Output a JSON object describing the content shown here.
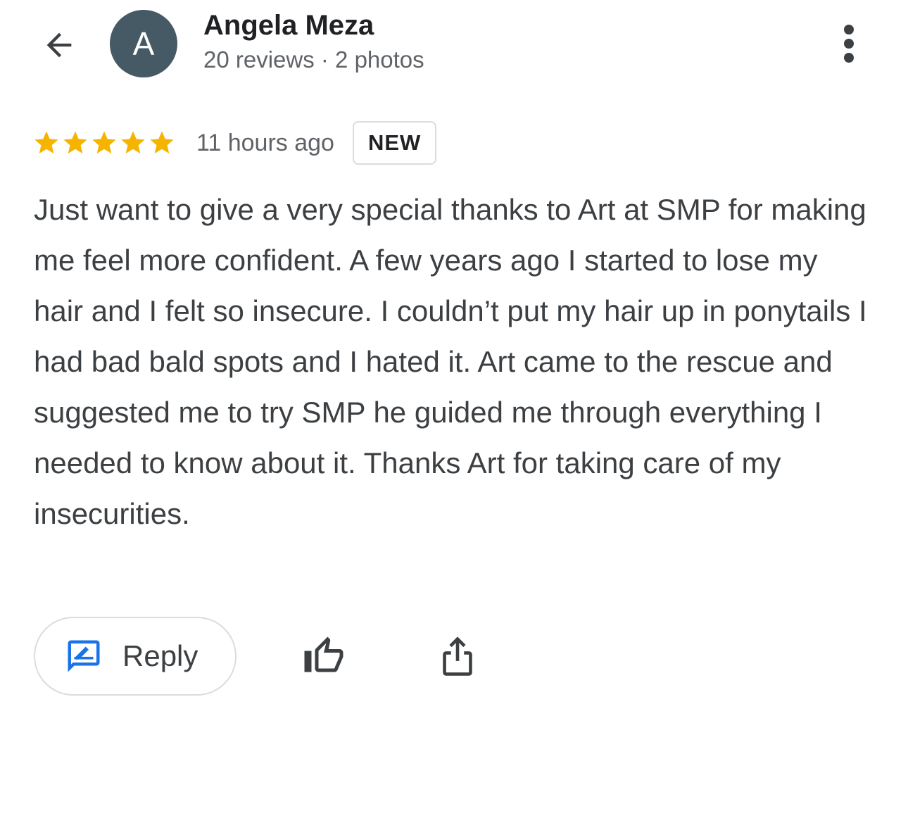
{
  "header": {
    "avatar_letter": "A",
    "reviewer_name": "Angela Meza",
    "reviewer_meta": "20 reviews · 2 photos"
  },
  "review": {
    "rating": 5,
    "rating_max": 5,
    "time_ago": "11 hours ago",
    "badge": "NEW",
    "text": "Just want to give a very special thanks to Art at SMP for making me feel more confident. A few years ago I started to lose my hair and I felt so insecure. I couldn’t put my hair up in ponytails I had bad bald spots and I hated it. Art came to the rescue and suggested me to try SMP he guided me through everything I needed to know about it. Thanks Art for taking care of my insecurities."
  },
  "actions": {
    "reply_label": "Reply"
  },
  "icons": {
    "back": "arrow-back-icon",
    "more": "more-vertical-icon",
    "star": "star-icon",
    "reply": "rate-review-icon",
    "like": "thumb-up-icon",
    "share": "share-icon"
  },
  "colors": {
    "star": "#f4b400",
    "reply_icon": "#1a73e8",
    "avatar_bg": "#455a64"
  }
}
